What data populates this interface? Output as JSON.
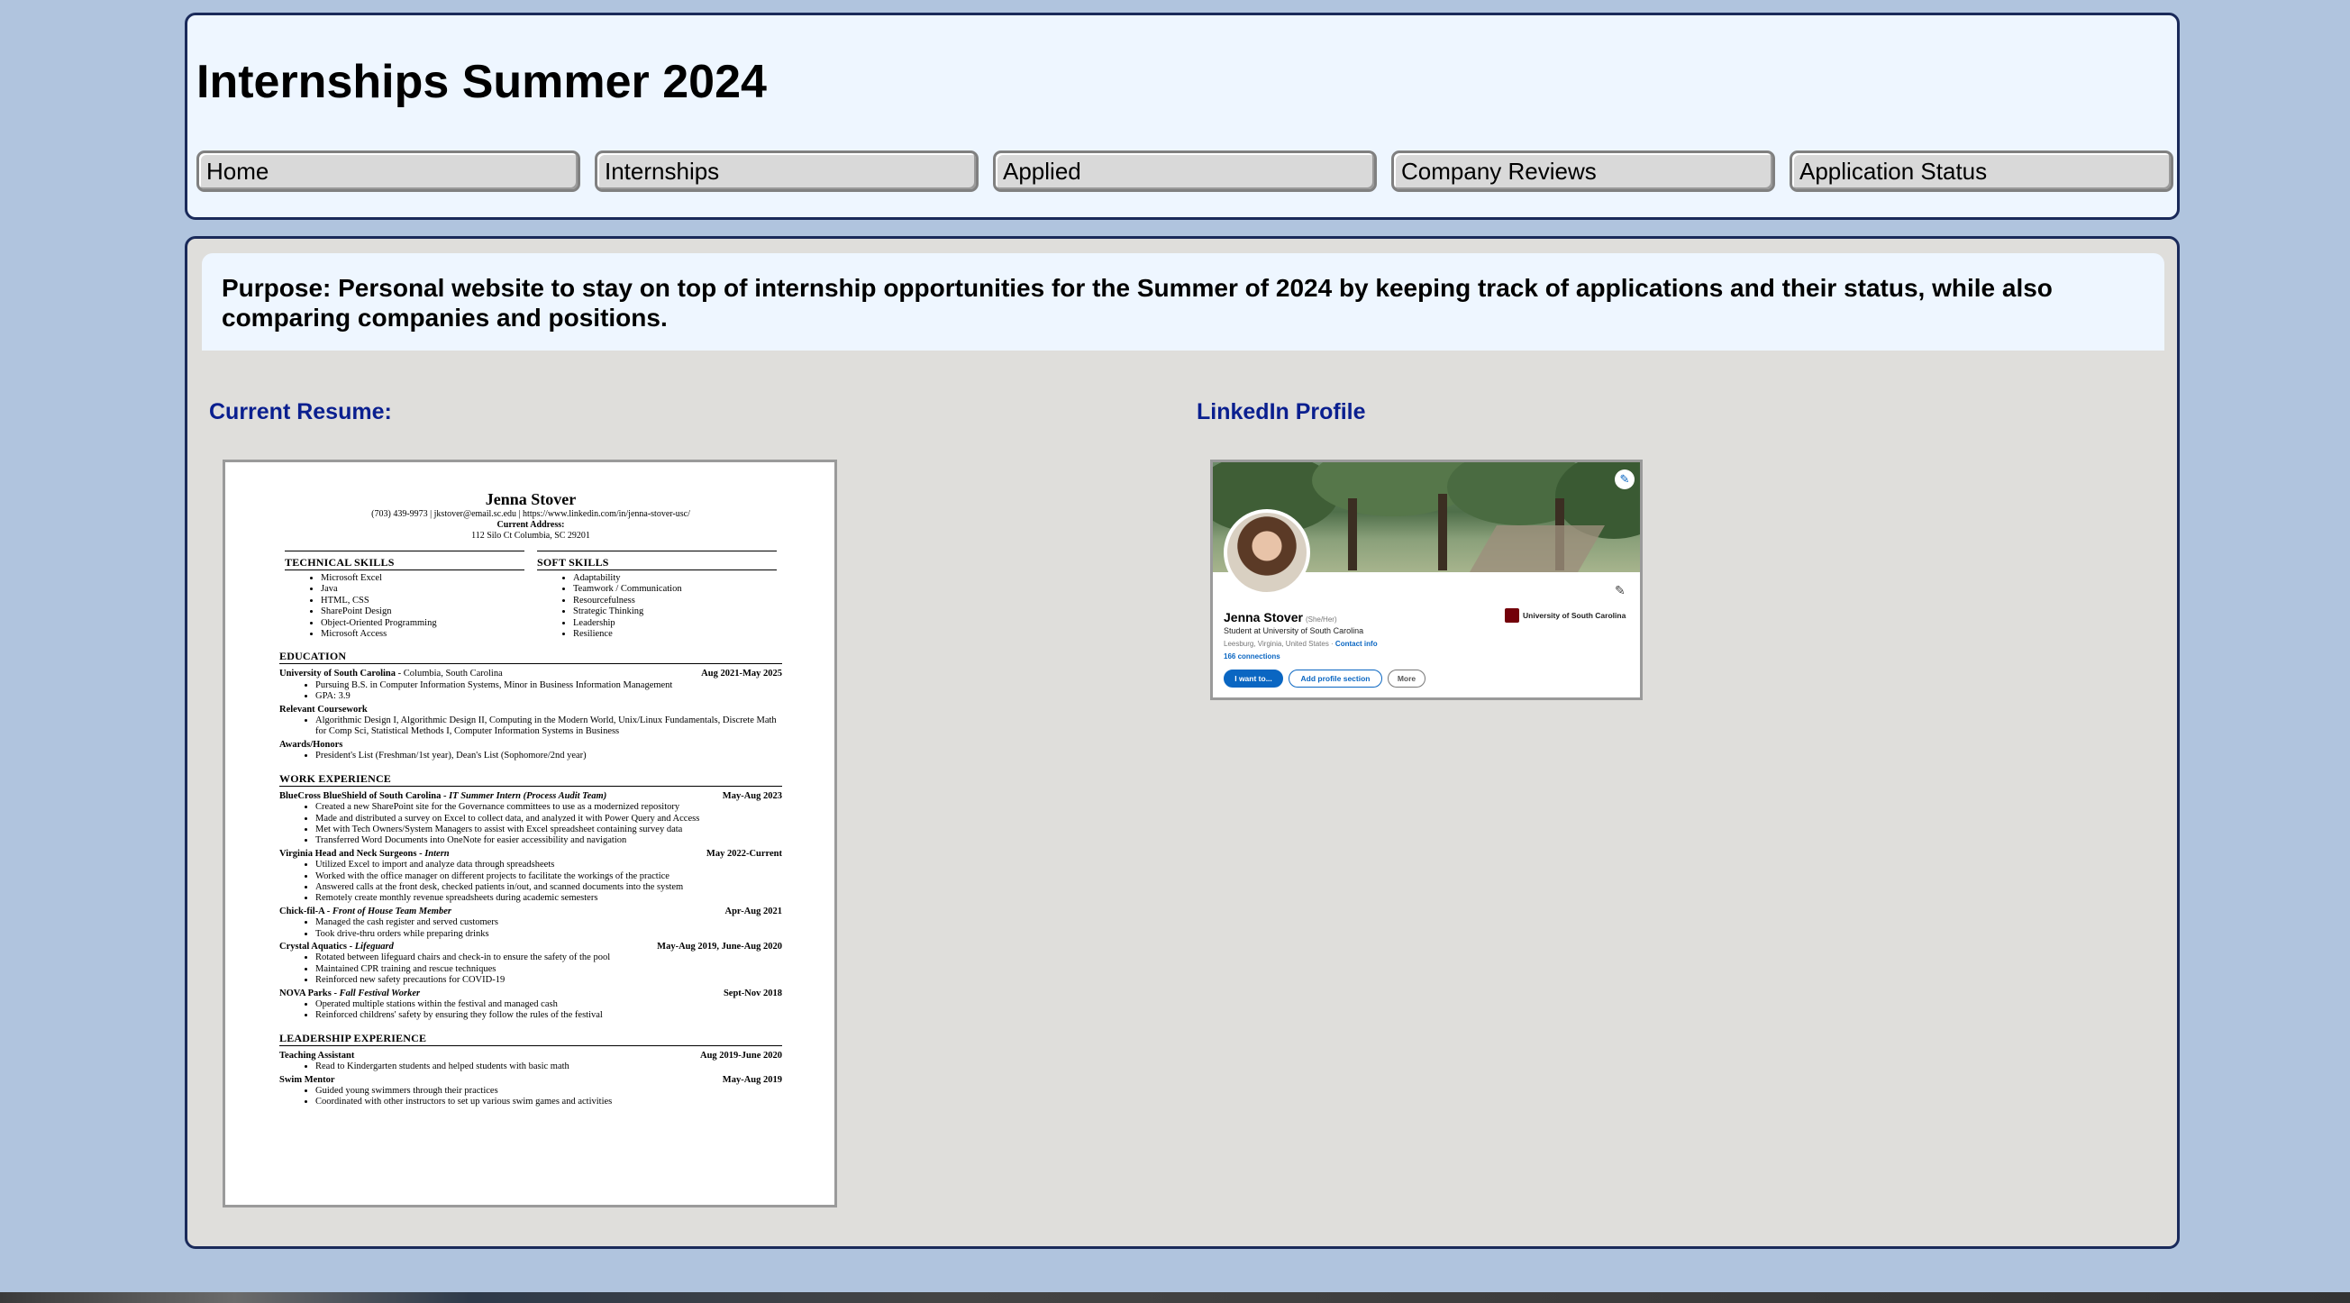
{
  "header": {
    "title": "Internships Summer 2024",
    "nav": [
      "Home",
      "Internships",
      "Applied",
      "Company Reviews",
      "Application Status"
    ]
  },
  "main": {
    "purpose": "Purpose: Personal website to stay on top of internship opportunities for the Summer of 2024 by keeping track of applications and their status, while also comparing companies and positions.",
    "resume_label": "Current Resume:",
    "linkedin_label": "LinkedIn Profile"
  },
  "resume": {
    "name": "Jenna Stover",
    "contact": "(703) 439-9973 |  jkstover@email.sc.edu | https://www.linkedin.com/in/jenna-stover-usc/",
    "address_label": "Current Address:",
    "address": "112 Silo Ct Columbia, SC 29201",
    "technical_skills_heading": "TECHNICAL SKILLS",
    "technical_skills": [
      "Microsoft Excel",
      "Java",
      "HTML, CSS",
      "SharePoint Design",
      "Object-Oriented Programming",
      "Microsoft Access"
    ],
    "soft_skills_heading": "SOFT SKILLS",
    "soft_skills": [
      "Adaptability",
      "Teamwork / Communication",
      "Resourcefulness",
      "Strategic Thinking",
      "Leadership",
      "Resilience"
    ],
    "education_heading": "EDUCATION",
    "edu_school": "University of South Carolina",
    "edu_location": " - Columbia, South Carolina",
    "edu_dates": "Aug 2021-May 2025",
    "edu_items": [
      "Pursuing B.S. in Computer Information Systems, Minor in Business Information Management",
      "GPA: 3.9"
    ],
    "coursework_label": "Relevant Coursework",
    "coursework": "Algorithmic Design I, Algorithmic Design II, Computing in the Modern World, Unix/Linux Fundamentals, Discrete Math for Comp Sci, Statistical Methods I, Computer Information Systems in Business",
    "awards_label": "Awards/Honors",
    "awards": "President's List (Freshman/1st year), Dean's List (Sophomore/2nd year)",
    "work_heading": "WORK EXPERIENCE",
    "jobs": [
      {
        "org": "BlueCross BlueShield of South Carolina - ",
        "role": "IT Summer Intern (Process Audit Team)",
        "dates": "May-Aug 2023",
        "items": [
          "Created a new SharePoint site for the Governance committees to use as a modernized repository",
          "Made and distributed a survey on Excel to collect data, and analyzed it with Power Query and Access",
          "Met with Tech Owners/System Managers to assist with Excel spreadsheet containing survey data",
          "Transferred Word Documents into OneNote for easier accessibility and navigation"
        ]
      },
      {
        "org": "Virginia Head and Neck Surgeons - ",
        "role": "Intern",
        "dates": "May 2022-Current",
        "items": [
          "Utilized Excel to import and analyze data through spreadsheets",
          "Worked with the office manager on different projects to facilitate the workings of the practice",
          "Answered calls at the front desk, checked patients in/out, and scanned documents into the system",
          "Remotely create monthly revenue spreadsheets during academic semesters"
        ]
      },
      {
        "org": "Chick-fil-A - ",
        "role": "Front of House Team Member",
        "dates": "Apr-Aug 2021",
        "items": [
          "Managed the cash register and served customers",
          "Took drive-thru orders while preparing drinks"
        ]
      },
      {
        "org": "Crystal Aquatics - ",
        "role": "Lifeguard",
        "dates": "May-Aug 2019, June-Aug 2020",
        "items": [
          "Rotated between lifeguard chairs and check-in to ensure the safety of the pool",
          "Maintained CPR training and rescue techniques",
          "Reinforced new safety precautions for COVID-19"
        ]
      },
      {
        "org": "NOVA Parks - ",
        "role": "Fall Festival Worker",
        "dates": "Sept-Nov 2018",
        "items": [
          "Operated multiple stations within the festival and managed cash",
          "Reinforced childrens' safety by ensuring they follow the rules of the festival"
        ]
      }
    ],
    "leadership_heading": "LEADERSHIP EXPERIENCE",
    "leadership": [
      {
        "org": "Teaching Assistant",
        "dates": "Aug 2019-June 2020",
        "items": [
          "Read to Kindergarten students and helped students with basic math"
        ]
      },
      {
        "org": "Swim Mentor",
        "dates": "May-Aug 2019",
        "items": [
          "Guided young swimmers through their practices",
          "Coordinated with other instructors to set up various swim games and activities"
        ]
      }
    ]
  },
  "linkedin": {
    "name": "Jenna Stover",
    "pronouns": "(She/Her)",
    "headline": "Student at University of South Carolina",
    "location": "Leesburg, Virginia, United States · ",
    "contact_info": "Contact info",
    "connections": "166 connections",
    "school": "University of South Carolina",
    "btn_primary": "I want to...",
    "btn_add": "Add profile section",
    "btn_more": "More",
    "icons": [
      "edit-icon",
      "pencil-icon"
    ]
  },
  "colors": {
    "page_bg": "#b0c4de",
    "panel_bg": "#eef6ff",
    "main_bg": "#dfdedb",
    "border": "#1a2a5a",
    "section_label": "#0a1f8f",
    "linkedin_blue": "#0a66c2"
  }
}
